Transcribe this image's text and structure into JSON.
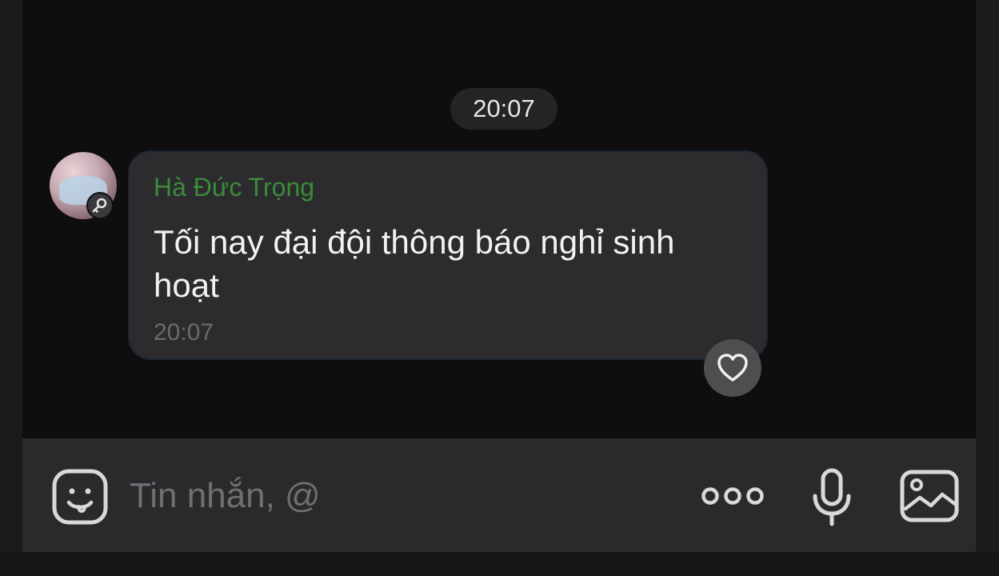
{
  "chat": {
    "time_divider": "20:07",
    "messages": [
      {
        "sender": "Hà Đức Trọng",
        "text": "Tối nay đại đội thông báo nghỉ sinh hoạt",
        "time": "20:07",
        "avatar_icon": "avatar-key-badge-icon"
      }
    ],
    "reaction_icon": "heart-outline-icon"
  },
  "composer": {
    "placeholder": "Tin nhắn, @",
    "icons": [
      "sticker-icon",
      "more-options-icon",
      "microphone-icon",
      "image-icon"
    ]
  },
  "colors": {
    "sender_name": "#3c8a3a",
    "bubble": "#2c2c2f",
    "chat_background": "#0e0e10",
    "composer_background": "#2a2a2d"
  }
}
